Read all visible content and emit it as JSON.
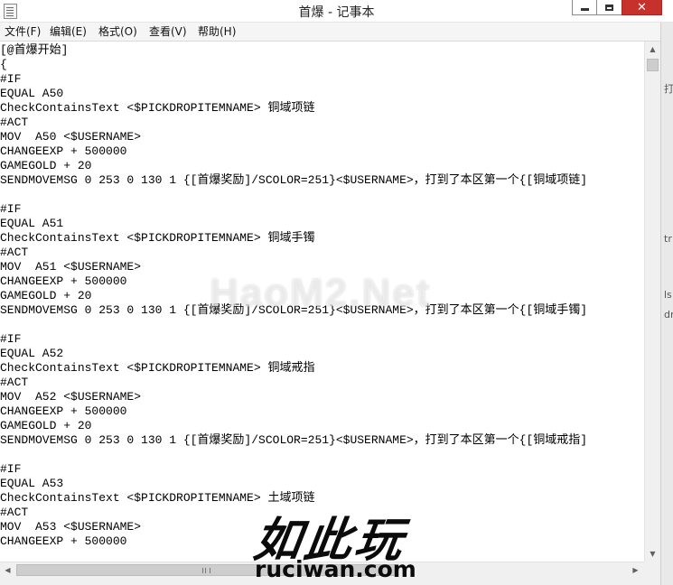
{
  "window": {
    "title": "首爆 - 记事本"
  },
  "menu": {
    "items": [
      {
        "label": "文件(F)"
      },
      {
        "label": "编辑(E)"
      },
      {
        "label": "格式(O)"
      },
      {
        "label": "查看(V)"
      },
      {
        "label": "帮助(H)"
      }
    ]
  },
  "editor": {
    "lines": [
      "[@首爆开始]",
      "{",
      "#IF",
      "EQUAL A50",
      "CheckContainsText <$PICKDROPITEMNAME> 铜域项链",
      "#ACT",
      "MOV  A50 <$USERNAME>",
      "CHANGEEXP + 500000",
      "GAMEGOLD + 20",
      "SENDMOVEMSG 0 253 0 130 1 {[首爆奖励]/SCOLOR=251}<$USERNAME>，打到了本区第一个{[铜域项链]",
      "",
      "#IF",
      "EQUAL A51",
      "CheckContainsText <$PICKDROPITEMNAME> 铜域手镯",
      "#ACT",
      "MOV  A51 <$USERNAME>",
      "CHANGEEXP + 500000",
      "GAMEGOLD + 20",
      "SENDMOVEMSG 0 253 0 130 1 {[首爆奖励]/SCOLOR=251}<$USERNAME>，打到了本区第一个{[铜域手镯]",
      "",
      "#IF",
      "EQUAL A52",
      "CheckContainsText <$PICKDROPITEMNAME> 铜域戒指",
      "#ACT",
      "MOV  A52 <$USERNAME>",
      "CHANGEEXP + 500000",
      "GAMEGOLD + 20",
      "SENDMOVEMSG 0 253 0 130 1 {[首爆奖励]/SCOLOR=251}<$USERNAME>，打到了本区第一个{[铜域戒指]",
      "",
      "#IF",
      "EQUAL A53",
      "CheckContainsText <$PICKDROPITEMNAME> 土域项链",
      "#ACT",
      "MOV  A53 <$USERNAME>",
      "CHANGEEXP + 500000"
    ]
  },
  "background_window": {
    "glyphs": [
      "打",
      "tr",
      "ls",
      "dr"
    ]
  },
  "watermarks": {
    "site": "HaoM2.Net",
    "logo_text": "如此玩",
    "logo_url": "ruciwan.com"
  },
  "icons": {
    "app": "notepad-icon",
    "minimize": "minimize-icon",
    "maximize": "maximize-icon",
    "close": "close-icon"
  }
}
